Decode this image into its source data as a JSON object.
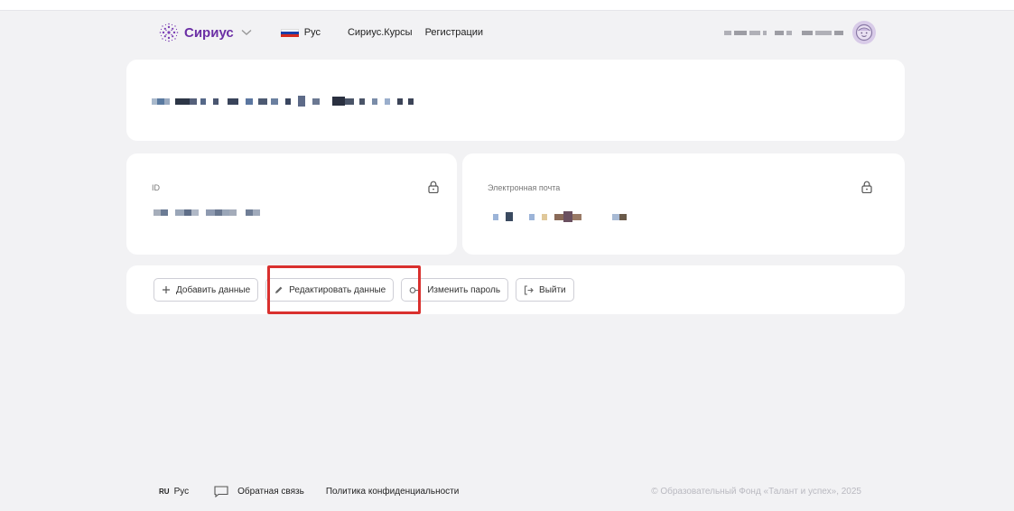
{
  "header": {
    "logo_text": "Сириус",
    "language_label": "Рус",
    "nav_links": [
      "Сириус.Курсы",
      "Регистрации"
    ]
  },
  "profile": {
    "id_label": "ID",
    "email_label": "Электронная почта"
  },
  "actions": {
    "add_data": "Добавить данные",
    "edit_data": "Редактировать данные",
    "change_password": "Изменить пароль",
    "logout": "Выйти"
  },
  "footer": {
    "lang_code": "RU",
    "lang_label": "Рус",
    "feedback": "Обратная связь",
    "privacy": "Политика конфиденциальности",
    "copyright": "© Образовательный Фонд «Талант и успех», 2025"
  },
  "colors": {
    "brand_purple": "#6b2fa5",
    "highlight_red": "#d9302e",
    "page_bg": "#f2f2f4"
  },
  "icons": {
    "logo": "sirius-dots-logo",
    "lock": "lock-icon",
    "add": "plus-icon",
    "edit": "pencil-icon",
    "password": "key-icon",
    "logout": "logout-icon",
    "feedback": "chat-bubble-icon",
    "avatar": "smiley-avatar-icon"
  }
}
